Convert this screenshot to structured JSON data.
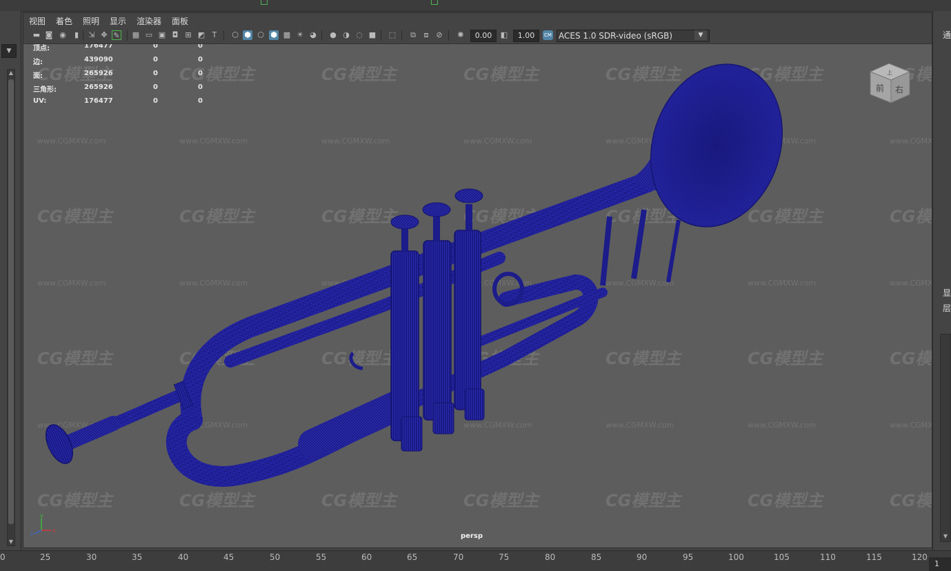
{
  "menu": {
    "items": [
      "视图",
      "着色",
      "照明",
      "显示",
      "渲染器",
      "面板"
    ]
  },
  "toolbar": {
    "exposure_value": "0.00",
    "gamma_value": "1.00",
    "color_space": "ACES 1.0 SDR-video (sRGB)",
    "icons": [
      "camera-icon",
      "camera-attributes-icon",
      "bookmark-icon",
      "image-plane-icon",
      "grid-icon",
      "film-gate-icon",
      "resolution-gate-icon",
      "gate-mask-icon",
      "field-chart-icon",
      "safe-action-icon",
      "safe-title-icon",
      "wireframe-icon",
      "smooth-shade-icon",
      "wireframe-on-shaded-icon",
      "textured-icon",
      "lights-icon",
      "shadows-icon",
      "ambient-occlusion-icon",
      "motion-blur-icon",
      "anti-aliasing-icon",
      "depth-of-field-icon",
      "isolate-select-icon",
      "xray-icon",
      "xray-joints-icon",
      "backface-culling-icon",
      "exposure-icon",
      "gamma-icon",
      "color-management-icon"
    ]
  },
  "heads_up": {
    "rows": [
      {
        "label": "顶点:",
        "v1": "176477",
        "v2": "0",
        "v3": "0"
      },
      {
        "label": "边:",
        "v1": "439090",
        "v2": "0",
        "v3": "0"
      },
      {
        "label": "面:",
        "v1": "265926",
        "v2": "0",
        "v3": "0"
      },
      {
        "label": "三角形:",
        "v1": "265926",
        "v2": "0",
        "v3": "0"
      },
      {
        "label": "UV:",
        "v1": "176477",
        "v2": "0",
        "v3": "0"
      }
    ]
  },
  "viewport": {
    "camera_label": "persp",
    "view_cube": {
      "front": "前",
      "right": "右",
      "top": "上"
    },
    "axis": {
      "y": "y",
      "x": "x",
      "z": "z"
    },
    "wireframe_color": "#1a1a8c",
    "background_color": "#5d5d5d"
  },
  "watermark": {
    "logo": "CG模型主",
    "url": "www.CGMXW.com"
  },
  "right_panel": {
    "labels": [
      "通",
      "显",
      "层"
    ]
  },
  "timeline": {
    "ticks": [
      "0",
      "25",
      "30",
      "35",
      "40",
      "45",
      "50",
      "55",
      "60",
      "65",
      "70",
      "75",
      "80",
      "85",
      "90",
      "95",
      "100",
      "105",
      "110",
      "115",
      "120"
    ],
    "current_frame": "1"
  }
}
